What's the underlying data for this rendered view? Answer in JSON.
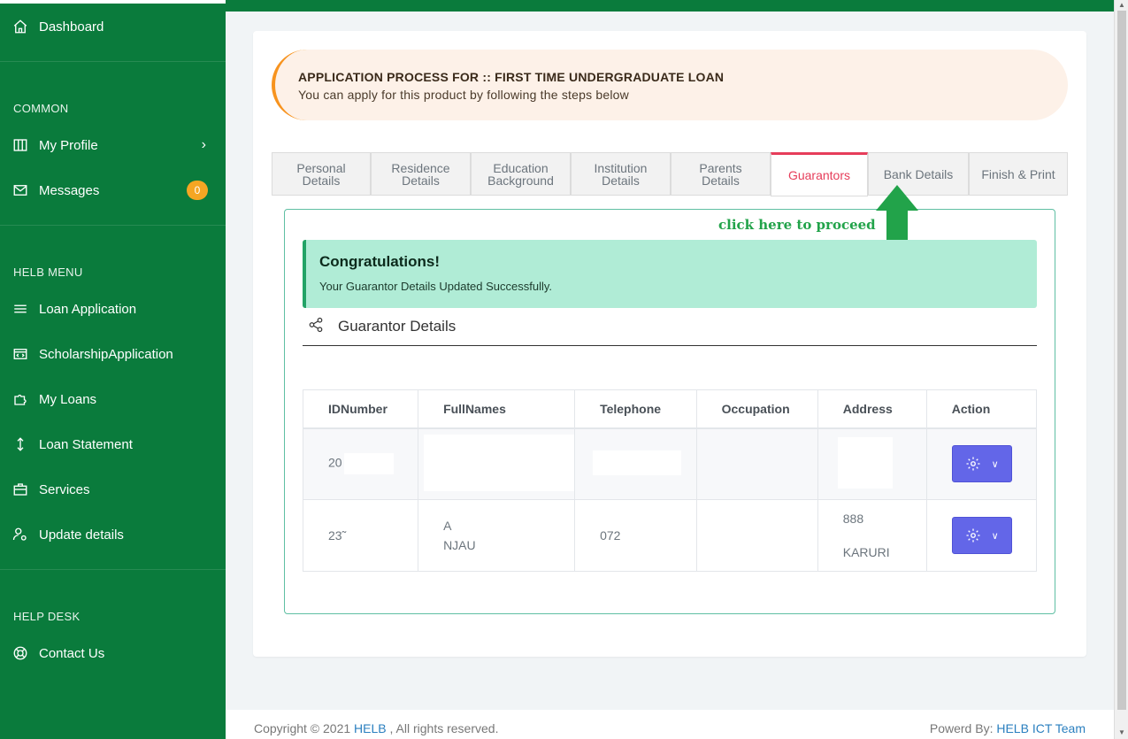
{
  "sidebar": {
    "dashboard": "Dashboard",
    "common_head": "COMMON",
    "my_profile": "My Profile",
    "messages": "Messages",
    "messages_badge": "0",
    "helb_head": "HELB MENU",
    "loan_application": "Loan Application",
    "scholarship_application": "ScholarshipApplication",
    "my_loans": "My Loans",
    "loan_statement": "Loan Statement",
    "services": "Services",
    "update_details": "Update details",
    "help_head": "HELP DESK",
    "contact_us": "Contact Us"
  },
  "banner": {
    "title": "APPLICATION PROCESS FOR :: FIRST TIME UNDERGRADUATE LOAN",
    "subtitle": "You can apply for this product by following the steps below"
  },
  "tabs": [
    {
      "line1": "Personal",
      "line2": "Details"
    },
    {
      "line1": "Residence",
      "line2": "Details"
    },
    {
      "line1": "Education",
      "line2": "Background"
    },
    {
      "line1": "Institution",
      "line2": "Details"
    },
    {
      "line1": "Parents",
      "line2": "Details"
    },
    {
      "line1": "Guarantors",
      "line2": ""
    },
    {
      "line1": "Bank Details",
      "line2": ""
    },
    {
      "line1": "Finish & Print",
      "line2": ""
    }
  ],
  "active_tab": "Guarantors",
  "hint": "click here to proceed",
  "alert": {
    "heading": "Congratulations!",
    "message": "Your Guarantor Details Updated Successfully."
  },
  "section_title": "Guarantor Details",
  "table": {
    "headers": [
      "IDNumber",
      "FullNames",
      "Telephone",
      "Occupation",
      "Address",
      "Action"
    ],
    "rows": [
      {
        "id": "20",
        "name1": "",
        "name2": "",
        "tel": "",
        "occ": "",
        "addr1": "",
        "addr2": ""
      },
      {
        "id": "23̃",
        "name1": "A",
        "name2": "NJAU",
        "tel": "072",
        "occ": "",
        "addr1": "888",
        "addr2": "KARURI"
      }
    ]
  },
  "footer": {
    "copyright": "Copyright © 2021 ",
    "helb": "HELB",
    "rights": " , All rights reserved.",
    "powered": "Powerd By: ",
    "team": "HELB ICT Team"
  },
  "colors": {
    "sidebar": "#0a7b3c",
    "active_tab": "#e63d5a",
    "action_button": "#6366e8",
    "alert_bg": "#b0ecd6",
    "hint": "#22a34a"
  }
}
